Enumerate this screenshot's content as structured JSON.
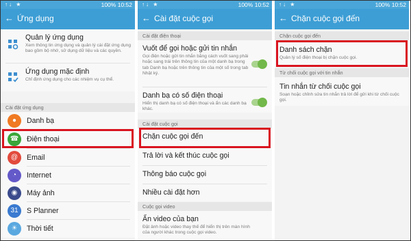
{
  "status": {
    "icons": "↑↓ ★",
    "battery": "100%",
    "time": "10:52"
  },
  "panel1": {
    "title": "Ứng dụng",
    "items": [
      {
        "title": "Quản lý ứng dụng",
        "subtitle": "Xem thông tin ứng dụng và quản lý cài đặt ứng dụng bao gồm bộ nhớ, sử dụng dữ liệu và các quyền."
      },
      {
        "title": "Ứng dụng mặc định",
        "subtitle": "Chỉ định ứng dụng cho các nhiệm vụ cụ thể."
      }
    ],
    "section": "Cài đặt ứng dụng",
    "apps": [
      {
        "label": "Danh bạ",
        "color": "#f07a22",
        "icon": "contacts-icon"
      },
      {
        "label": "Điện thoại",
        "color": "#3aa63a",
        "icon": "phone-icon"
      },
      {
        "label": "Email",
        "color": "#e24a3c",
        "icon": "email-icon"
      },
      {
        "label": "Internet",
        "color": "#6459c9",
        "icon": "internet-icon"
      },
      {
        "label": "Máy ảnh",
        "color": "#3a4a8c",
        "icon": "camera-icon"
      },
      {
        "label": "S Planner",
        "color": "#3a7ad0",
        "icon": "planner-icon"
      },
      {
        "label": "Thời tiết",
        "color": "#5aa8e0",
        "icon": "weather-icon"
      }
    ]
  },
  "panel2": {
    "title": "Cài đặt cuộc gọi",
    "section1": "Cài đặt điện thoại",
    "swipe": {
      "title": "Vuốt để gọi hoặc gửi tin nhắn",
      "subtitle": "Gọi điện hoặc gửi tin nhắn bằng cách vuốt sang phải hoặc sang trái trên thông tin của một danh bạ trong tab Danh bạ hoặc trên thông tin của một số trong tab Nhật ký.",
      "enabled": true
    },
    "contactsWithNumber": {
      "title": "Danh bạ có số điện thoại",
      "subtitle": "Hiển thị danh bạ có số điện thoại và ẩn các danh bạ khác.",
      "enabled": true
    },
    "section2": "Cài đặt cuộc gọi",
    "items": [
      "Chặn cuộc gọi đến",
      "Trả lời và kết thúc cuộc gọi",
      "Thông báo cuộc gọi",
      "Nhiều cài đặt hơn"
    ],
    "section3": "Cuộc gọi video",
    "video": {
      "title": "Ẩn video của bạn",
      "subtitle": "Đặt ảnh hoặc video thay thế để hiển thị trên màn hình của người khác trong cuộc gọi video."
    }
  },
  "panel3": {
    "title": "Chặn cuộc gọi đến",
    "section1": "Chặn cuộc gọi đến",
    "blockList": {
      "title": "Danh sách chặn",
      "subtitle": "Quản lý số điện thoại bị chặn cuộc gọi."
    },
    "section2": "Từ chối cuộc gọi với tin nhắn",
    "rejectMsg": {
      "title": "Tin nhắn từ chối cuộc gọi",
      "subtitle": "Soạn hoặc chỉnh sửa tin nhắn trả lời để gửi khi từ chối cuộc gọi."
    }
  },
  "highlightColor": "#d9141f"
}
